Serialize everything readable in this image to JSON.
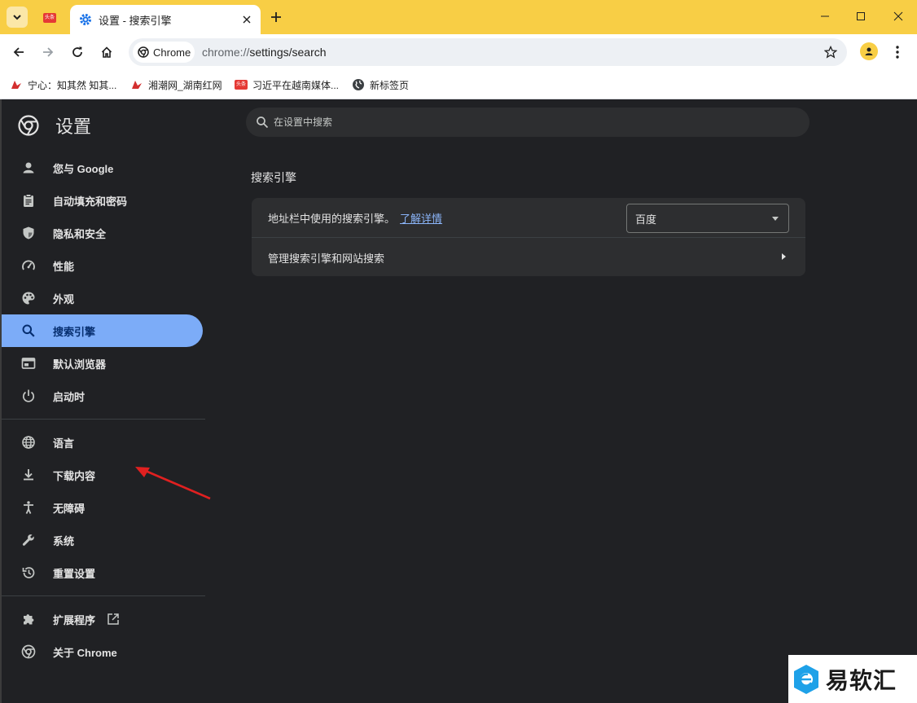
{
  "tab": {
    "title": "设置 - 搜索引擎",
    "pinned_badge": "头条"
  },
  "toolbar": {
    "chip_label": "Chrome",
    "url_scheme": "chrome://",
    "url_path": "settings/search"
  },
  "bookmarks": [
    {
      "label": "宁心：知其然 知其..."
    },
    {
      "label": "湘潮网_湖南红网"
    },
    {
      "label": "习近平在越南媒体..."
    },
    {
      "label": "新标签页"
    }
  ],
  "settings": {
    "title": "设置",
    "search_placeholder": "在设置中搜索",
    "nav": [
      {
        "label": "您与 Google",
        "icon": "person-icon"
      },
      {
        "label": "自动填充和密码",
        "icon": "clipboard-icon"
      },
      {
        "label": "隐私和安全",
        "icon": "shield-icon"
      },
      {
        "label": "性能",
        "icon": "speedometer-icon"
      },
      {
        "label": "外观",
        "icon": "palette-icon"
      },
      {
        "label": "搜索引擎",
        "icon": "search-icon",
        "active": true
      },
      {
        "label": "默认浏览器",
        "icon": "browser-icon"
      },
      {
        "label": "启动时",
        "icon": "power-icon"
      }
    ],
    "nav2": [
      {
        "label": "语言",
        "icon": "globe-icon"
      },
      {
        "label": "下载内容",
        "icon": "download-icon"
      },
      {
        "label": "无障碍",
        "icon": "accessibility-icon"
      },
      {
        "label": "系统",
        "icon": "wrench-icon"
      },
      {
        "label": "重置设置",
        "icon": "history-icon"
      }
    ],
    "nav3": [
      {
        "label": "扩展程序",
        "icon": "puzzle-icon"
      },
      {
        "label": "关于 Chrome",
        "icon": "chrome-icon"
      }
    ],
    "section_title": "搜索引擎",
    "row1_text": "地址栏中使用的搜索引擎。",
    "row1_link": "了解详情",
    "engine_selected": "百度",
    "row2_text": "管理搜索引擎和网站搜索"
  },
  "watermark": {
    "text": "易软汇"
  },
  "colors": {
    "tabstrip": "#f8ce45",
    "page_bg": "#202124",
    "active_nav": "#7cacf8",
    "annotation": "#e02020"
  }
}
